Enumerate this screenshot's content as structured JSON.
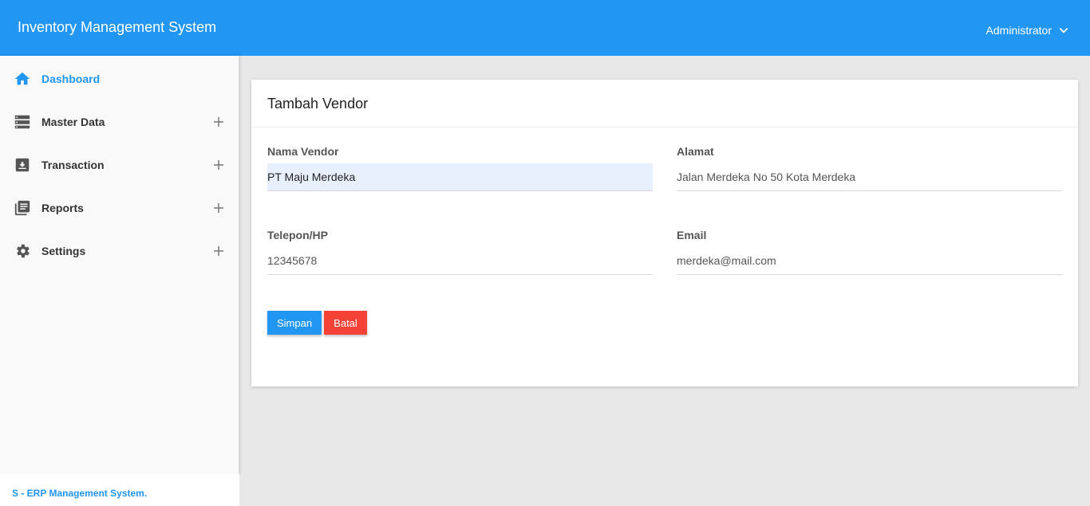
{
  "header": {
    "title": "Inventory Management System",
    "user": "Administrator"
  },
  "sidebar": {
    "items": [
      {
        "label": "Dashboard",
        "icon": "home-icon",
        "expandable": false,
        "active": true
      },
      {
        "label": "Master Data",
        "icon": "list-icon",
        "expandable": true,
        "active": false
      },
      {
        "label": "Transaction",
        "icon": "archive-icon",
        "expandable": true,
        "active": false
      },
      {
        "label": "Reports",
        "icon": "library-icon",
        "expandable": true,
        "active": false
      },
      {
        "label": "Settings",
        "icon": "gear-icon",
        "expandable": true,
        "active": false
      }
    ],
    "footer": "S - ERP Management System."
  },
  "form": {
    "title": "Tambah Vendor",
    "fields": [
      {
        "label": "Nama Vendor",
        "value": "PT Maju Merdeka"
      },
      {
        "label": "Alamat",
        "value": "Jalan Merdeka No 50 Kota Merdeka"
      },
      {
        "label": "Telepon/HP",
        "value": "12345678"
      },
      {
        "label": "Email",
        "value": "merdeka@mail.com"
      }
    ],
    "save_label": "Simpan",
    "cancel_label": "Batal"
  },
  "colors": {
    "primary": "#2196f3",
    "danger": "#f44336",
    "background": "#e8e8e8",
    "autofill": "#e8f0fe"
  }
}
